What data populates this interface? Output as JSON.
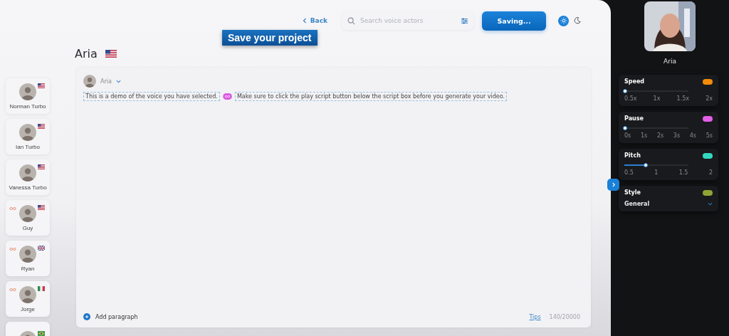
{
  "top_bar": {
    "back_label": "Back",
    "search": {
      "placeholder": "Search voice actors"
    },
    "save_button": "Saving...",
    "theme_options": [
      {
        "kind": "sun",
        "selected": true
      },
      {
        "kind": "moon",
        "selected": false
      }
    ]
  },
  "overlay_caption": "Save your project",
  "title": {
    "name": "Aria",
    "kind": "us"
  },
  "voices": [
    {
      "name": "Norman Turbo",
      "kind": "us",
      "badge": false
    },
    {
      "name": "Ian Turbo",
      "kind": "us",
      "badge": false
    },
    {
      "name": "Vanessa Turbo",
      "kind": "us",
      "badge": false
    },
    {
      "name": "Guy",
      "kind": "us",
      "badge": true
    },
    {
      "name": "Ryan",
      "kind": "gb",
      "badge": true
    },
    {
      "name": "Jorge",
      "kind": "mx",
      "badge": true
    },
    {
      "kind": "br",
      "badge": false
    }
  ],
  "editor": {
    "voice_name": "Aria",
    "segments": [
      {
        "kind": "sentence",
        "text": "This is a demo of the voice you have selected."
      },
      {
        "kind": "pause"
      },
      {
        "kind": "sentence",
        "text": "Make sure to click the play script button below the script box before you generate your video."
      }
    ],
    "add_paragraph": "Add paragraph",
    "tips_link": "Tips",
    "char_count": "140/20000"
  },
  "voice_panel": {
    "name": "Aria",
    "settings": [
      {
        "kind": "slider",
        "label": "Speed",
        "color": "#f28c0a",
        "level": 0,
        "ticks": [
          "0.5x",
          "1x",
          "1.5x",
          "2x"
        ]
      },
      {
        "kind": "slider",
        "label": "Pause",
        "color": "#e45ee8",
        "level": 0,
        "ticks": [
          "0s",
          "1s",
          "2s",
          "3s",
          "4s",
          "5s"
        ]
      },
      {
        "kind": "slider",
        "label": "Pitch",
        "color": "#33d8c0",
        "level": 0.33,
        "ticks": [
          "0.5",
          "1",
          "1.5",
          "2"
        ]
      },
      {
        "kind": "select",
        "label": "Style",
        "color": "#8fa434",
        "value": "General"
      }
    ]
  }
}
